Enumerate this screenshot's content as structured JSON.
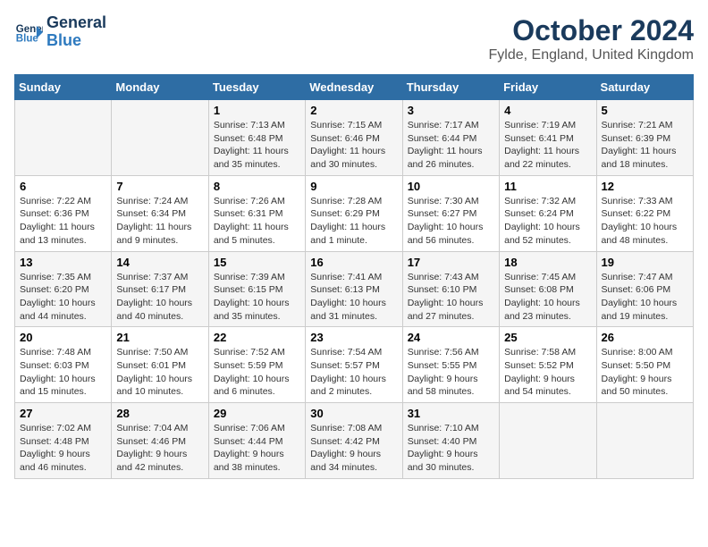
{
  "header": {
    "logo_line1": "General",
    "logo_line2": "Blue",
    "month": "October 2024",
    "location": "Fylde, England, United Kingdom"
  },
  "weekdays": [
    "Sunday",
    "Monday",
    "Tuesday",
    "Wednesday",
    "Thursday",
    "Friday",
    "Saturday"
  ],
  "weeks": [
    [
      {
        "day": "",
        "sunrise": "",
        "sunset": "",
        "daylight": ""
      },
      {
        "day": "",
        "sunrise": "",
        "sunset": "",
        "daylight": ""
      },
      {
        "day": "1",
        "sunrise": "Sunrise: 7:13 AM",
        "sunset": "Sunset: 6:48 PM",
        "daylight": "Daylight: 11 hours and 35 minutes."
      },
      {
        "day": "2",
        "sunrise": "Sunrise: 7:15 AM",
        "sunset": "Sunset: 6:46 PM",
        "daylight": "Daylight: 11 hours and 30 minutes."
      },
      {
        "day": "3",
        "sunrise": "Sunrise: 7:17 AM",
        "sunset": "Sunset: 6:44 PM",
        "daylight": "Daylight: 11 hours and 26 minutes."
      },
      {
        "day": "4",
        "sunrise": "Sunrise: 7:19 AM",
        "sunset": "Sunset: 6:41 PM",
        "daylight": "Daylight: 11 hours and 22 minutes."
      },
      {
        "day": "5",
        "sunrise": "Sunrise: 7:21 AM",
        "sunset": "Sunset: 6:39 PM",
        "daylight": "Daylight: 11 hours and 18 minutes."
      }
    ],
    [
      {
        "day": "6",
        "sunrise": "Sunrise: 7:22 AM",
        "sunset": "Sunset: 6:36 PM",
        "daylight": "Daylight: 11 hours and 13 minutes."
      },
      {
        "day": "7",
        "sunrise": "Sunrise: 7:24 AM",
        "sunset": "Sunset: 6:34 PM",
        "daylight": "Daylight: 11 hours and 9 minutes."
      },
      {
        "day": "8",
        "sunrise": "Sunrise: 7:26 AM",
        "sunset": "Sunset: 6:31 PM",
        "daylight": "Daylight: 11 hours and 5 minutes."
      },
      {
        "day": "9",
        "sunrise": "Sunrise: 7:28 AM",
        "sunset": "Sunset: 6:29 PM",
        "daylight": "Daylight: 11 hours and 1 minute."
      },
      {
        "day": "10",
        "sunrise": "Sunrise: 7:30 AM",
        "sunset": "Sunset: 6:27 PM",
        "daylight": "Daylight: 10 hours and 56 minutes."
      },
      {
        "day": "11",
        "sunrise": "Sunrise: 7:32 AM",
        "sunset": "Sunset: 6:24 PM",
        "daylight": "Daylight: 10 hours and 52 minutes."
      },
      {
        "day": "12",
        "sunrise": "Sunrise: 7:33 AM",
        "sunset": "Sunset: 6:22 PM",
        "daylight": "Daylight: 10 hours and 48 minutes."
      }
    ],
    [
      {
        "day": "13",
        "sunrise": "Sunrise: 7:35 AM",
        "sunset": "Sunset: 6:20 PM",
        "daylight": "Daylight: 10 hours and 44 minutes."
      },
      {
        "day": "14",
        "sunrise": "Sunrise: 7:37 AM",
        "sunset": "Sunset: 6:17 PM",
        "daylight": "Daylight: 10 hours and 40 minutes."
      },
      {
        "day": "15",
        "sunrise": "Sunrise: 7:39 AM",
        "sunset": "Sunset: 6:15 PM",
        "daylight": "Daylight: 10 hours and 35 minutes."
      },
      {
        "day": "16",
        "sunrise": "Sunrise: 7:41 AM",
        "sunset": "Sunset: 6:13 PM",
        "daylight": "Daylight: 10 hours and 31 minutes."
      },
      {
        "day": "17",
        "sunrise": "Sunrise: 7:43 AM",
        "sunset": "Sunset: 6:10 PM",
        "daylight": "Daylight: 10 hours and 27 minutes."
      },
      {
        "day": "18",
        "sunrise": "Sunrise: 7:45 AM",
        "sunset": "Sunset: 6:08 PM",
        "daylight": "Daylight: 10 hours and 23 minutes."
      },
      {
        "day": "19",
        "sunrise": "Sunrise: 7:47 AM",
        "sunset": "Sunset: 6:06 PM",
        "daylight": "Daylight: 10 hours and 19 minutes."
      }
    ],
    [
      {
        "day": "20",
        "sunrise": "Sunrise: 7:48 AM",
        "sunset": "Sunset: 6:03 PM",
        "daylight": "Daylight: 10 hours and 15 minutes."
      },
      {
        "day": "21",
        "sunrise": "Sunrise: 7:50 AM",
        "sunset": "Sunset: 6:01 PM",
        "daylight": "Daylight: 10 hours and 10 minutes."
      },
      {
        "day": "22",
        "sunrise": "Sunrise: 7:52 AM",
        "sunset": "Sunset: 5:59 PM",
        "daylight": "Daylight: 10 hours and 6 minutes."
      },
      {
        "day": "23",
        "sunrise": "Sunrise: 7:54 AM",
        "sunset": "Sunset: 5:57 PM",
        "daylight": "Daylight: 10 hours and 2 minutes."
      },
      {
        "day": "24",
        "sunrise": "Sunrise: 7:56 AM",
        "sunset": "Sunset: 5:55 PM",
        "daylight": "Daylight: 9 hours and 58 minutes."
      },
      {
        "day": "25",
        "sunrise": "Sunrise: 7:58 AM",
        "sunset": "Sunset: 5:52 PM",
        "daylight": "Daylight: 9 hours and 54 minutes."
      },
      {
        "day": "26",
        "sunrise": "Sunrise: 8:00 AM",
        "sunset": "Sunset: 5:50 PM",
        "daylight": "Daylight: 9 hours and 50 minutes."
      }
    ],
    [
      {
        "day": "27",
        "sunrise": "Sunrise: 7:02 AM",
        "sunset": "Sunset: 4:48 PM",
        "daylight": "Daylight: 9 hours and 46 minutes."
      },
      {
        "day": "28",
        "sunrise": "Sunrise: 7:04 AM",
        "sunset": "Sunset: 4:46 PM",
        "daylight": "Daylight: 9 hours and 42 minutes."
      },
      {
        "day": "29",
        "sunrise": "Sunrise: 7:06 AM",
        "sunset": "Sunset: 4:44 PM",
        "daylight": "Daylight: 9 hours and 38 minutes."
      },
      {
        "day": "30",
        "sunrise": "Sunrise: 7:08 AM",
        "sunset": "Sunset: 4:42 PM",
        "daylight": "Daylight: 9 hours and 34 minutes."
      },
      {
        "day": "31",
        "sunrise": "Sunrise: 7:10 AM",
        "sunset": "Sunset: 4:40 PM",
        "daylight": "Daylight: 9 hours and 30 minutes."
      },
      {
        "day": "",
        "sunrise": "",
        "sunset": "",
        "daylight": ""
      },
      {
        "day": "",
        "sunrise": "",
        "sunset": "",
        "daylight": ""
      }
    ]
  ]
}
